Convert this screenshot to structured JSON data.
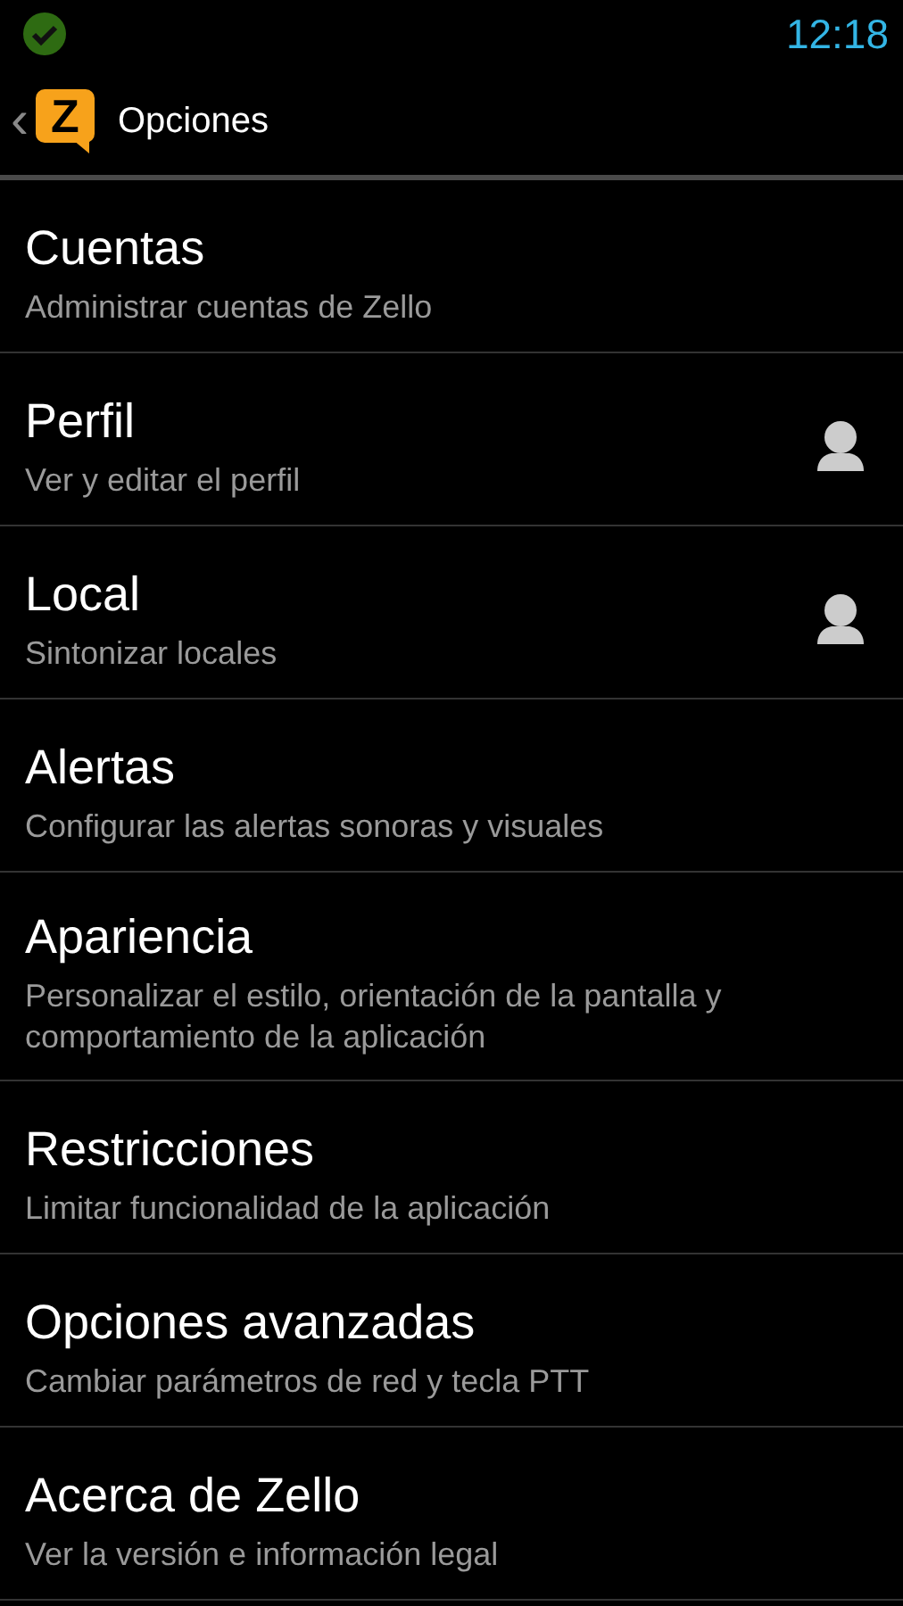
{
  "status_bar": {
    "time": "12:18",
    "sync_ok": true
  },
  "app_bar": {
    "back": "‹",
    "logo_text": "Z",
    "title": "Opciones"
  },
  "items": [
    {
      "title": "Cuentas",
      "summary": "Administrar cuentas de Zello",
      "account_icon": false
    },
    {
      "title": "Perfil",
      "summary": "Ver y editar el perfil",
      "account_icon": true
    },
    {
      "title": "Local",
      "summary": "Sintonizar locales",
      "account_icon": true
    },
    {
      "title": "Alertas",
      "summary": "Configurar las alertas sonoras y visuales",
      "account_icon": false
    },
    {
      "title": "Apariencia",
      "summary": "Personalizar el estilo, orientación de la pantalla y comportamiento de la aplicación",
      "account_icon": false
    },
    {
      "title": "Restricciones",
      "summary": "Limitar funcionalidad de la aplicación",
      "account_icon": false
    },
    {
      "title": "Opciones avanzadas",
      "summary": "Cambiar parámetros de red y tecla PTT",
      "account_icon": false
    },
    {
      "title": "Acerca de Zello",
      "summary": "Ver la versión e información legal",
      "account_icon": false
    }
  ]
}
